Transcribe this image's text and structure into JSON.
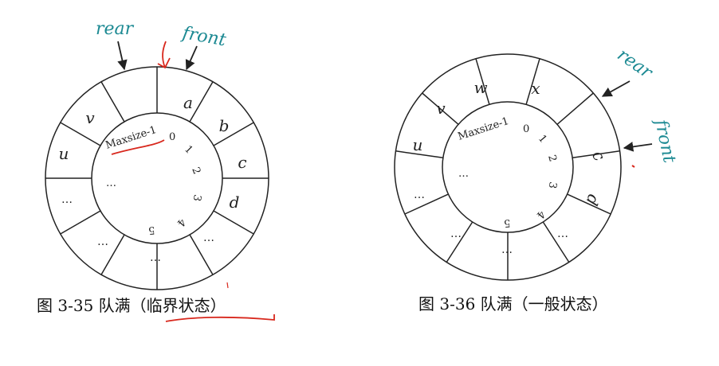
{
  "colors": {
    "ink": "#222222",
    "label": "#1d8a93",
    "annotation": "#d8281d"
  },
  "fig_left": {
    "caption": "图 3-35  队满（临界状态）",
    "segments": [
      "",
      "a",
      "b",
      "c",
      "d",
      "…",
      "…",
      "…",
      "…",
      "u",
      "v",
      ""
    ],
    "indices": [
      "Maxsize-1",
      "0",
      "1",
      "2",
      "3",
      "4",
      "5",
      "…"
    ],
    "rear_label": "rear",
    "front_label": "front"
  },
  "fig_right": {
    "caption": "图 3-36  队满（一般状态）",
    "segments": [
      "x",
      "",
      "c",
      "d",
      "…",
      "…",
      "…",
      "…",
      "u",
      "v",
      "w"
    ],
    "indices": [
      "Maxsize-1",
      "0",
      "1",
      "2",
      "3",
      "4",
      "5",
      "…"
    ],
    "rear_label": "rear",
    "front_label": "front"
  }
}
